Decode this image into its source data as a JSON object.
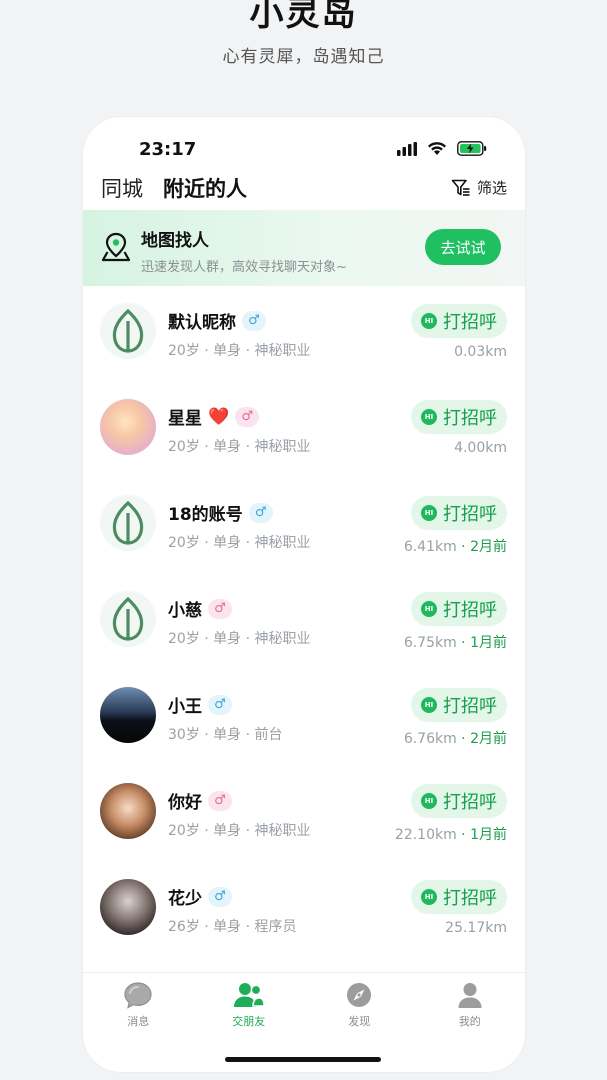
{
  "hero": {
    "title": "小灵岛",
    "subtitle": "心有灵犀，岛遇知己"
  },
  "status_bar": {
    "time": "23:17",
    "icons": [
      "cellular-icon",
      "wifi-icon",
      "battery-charging-icon"
    ]
  },
  "tabs": [
    {
      "label": "同城",
      "active": false
    },
    {
      "label": "附近的人",
      "active": true
    }
  ],
  "filter": {
    "label": "筛选",
    "icon": "filter-icon"
  },
  "map_banner": {
    "title": "地图找人",
    "description": "迅速发现人群，高效寻找聊天对象~",
    "button": "去试试",
    "icon": "map-pin-icon"
  },
  "greet_label": "打招呼",
  "hi_badge": "HI",
  "users": [
    {
      "name": "默认昵称",
      "heart": "",
      "gender": "male",
      "gender_symbol": "♂",
      "meta": "20岁 · 单身 · 神秘职业",
      "distance": "0.03km",
      "ago": "",
      "avatar": "leaf-avatar"
    },
    {
      "name": "星星",
      "heart": "❤️",
      "gender": "female",
      "gender_symbol": "♂",
      "meta": "20岁 · 单身 · 神秘职业",
      "distance": "4.00km",
      "ago": "",
      "avatar": "anime-girl-avatar"
    },
    {
      "name": "18的账号",
      "heart": "",
      "gender": "male",
      "gender_symbol": "♂",
      "meta": "20岁 · 单身 · 神秘职业",
      "distance": "6.41km",
      "ago": " · 2月前",
      "avatar": "leaf-avatar"
    },
    {
      "name": "小慈",
      "heart": "",
      "gender": "female",
      "gender_symbol": "♂",
      "meta": "20岁 · 单身 · 神秘职业",
      "distance": "6.75km",
      "ago": " · 1月前",
      "avatar": "leaf-avatar"
    },
    {
      "name": "小王",
      "heart": "",
      "gender": "male",
      "gender_symbol": "♂",
      "meta": "30岁 · 单身 · 前台",
      "distance": "6.76km",
      "ago": " · 2月前",
      "avatar": "night-scene-avatar"
    },
    {
      "name": "你好",
      "heart": "",
      "gender": "female",
      "gender_symbol": "♂",
      "meta": "20岁 · 单身 · 神秘职业",
      "distance": "22.10km",
      "ago": " · 1月前",
      "avatar": "anime-brunette-avatar"
    },
    {
      "name": "花少",
      "heart": "",
      "gender": "male",
      "gender_symbol": "♂",
      "meta": "26岁 · 单身 · 程序员",
      "distance": "25.17km",
      "ago": "",
      "avatar": "photo-girl-avatar"
    }
  ],
  "tabbar": [
    {
      "label": "消息",
      "icon": "chat-bubble-icon",
      "active": false
    },
    {
      "label": "交朋友",
      "icon": "friends-icon",
      "active": true
    },
    {
      "label": "发现",
      "icon": "compass-icon",
      "active": false
    },
    {
      "label": "我的",
      "icon": "person-icon",
      "active": false
    }
  ],
  "colors": {
    "accent": "#20c062",
    "greet_bg": "#e3f6e8",
    "greet_text": "#14a14d",
    "male": "#3aa4d8",
    "female": "#e06a9a"
  }
}
